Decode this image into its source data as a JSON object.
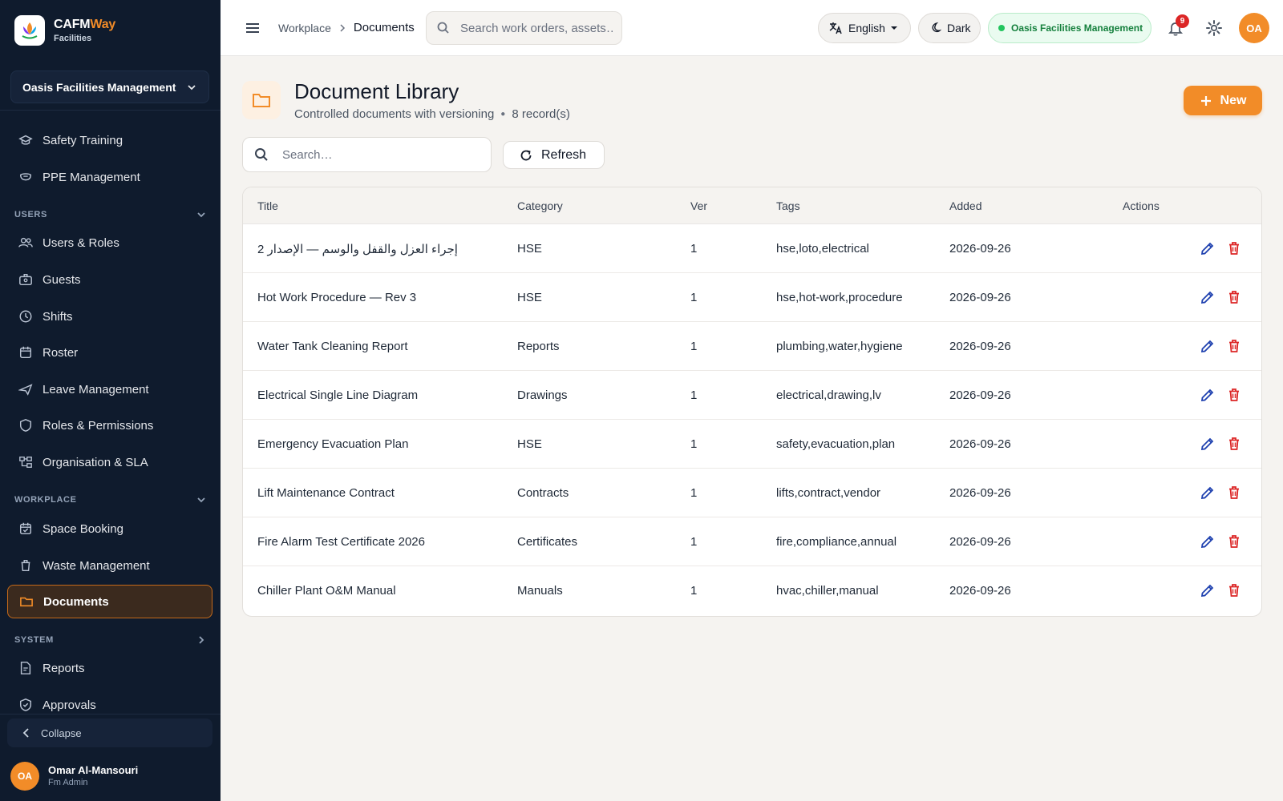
{
  "app": {
    "brand_name_main": "CAFM",
    "brand_name_accent": "Way",
    "brand_sub": "Facilities",
    "org_selector": "Oasis Facilities Management",
    "accent_color": "#f28c28"
  },
  "sidebar": {
    "top_items": [
      {
        "label": "Safety Training",
        "icon": "graduation-cap-icon"
      },
      {
        "label": "PPE Management",
        "icon": "mask-icon"
      }
    ],
    "sections": {
      "users": {
        "label": "USERS",
        "expanded": true
      },
      "workplace": {
        "label": "WORKPLACE",
        "expanded": true
      },
      "system": {
        "label": "SYSTEM",
        "expanded": false
      }
    },
    "users_items": [
      {
        "label": "Users & Roles",
        "icon": "users-icon"
      },
      {
        "label": "Guests",
        "icon": "badge-icon"
      },
      {
        "label": "Shifts",
        "icon": "clock-icon"
      },
      {
        "label": "Roster",
        "icon": "calendar-icon"
      },
      {
        "label": "Leave Management",
        "icon": "plane-icon"
      },
      {
        "label": "Roles & Permissions",
        "icon": "shield-icon"
      },
      {
        "label": "Organisation & SLA",
        "icon": "org-chart-icon"
      }
    ],
    "workplace_items": [
      {
        "label": "Space Booking",
        "icon": "calendar-check-icon"
      },
      {
        "label": "Waste Management",
        "icon": "trash-icon"
      },
      {
        "label": "Documents",
        "icon": "folder-icon",
        "active": true
      }
    ],
    "system_items": [
      {
        "label": "Reports",
        "icon": "report-icon"
      },
      {
        "label": "Approvals",
        "icon": "shield-check-icon"
      }
    ],
    "collapse_label": "Collapse",
    "user": {
      "initials": "OA",
      "name": "Omar Al-Mansouri",
      "role": "Fm Admin"
    }
  },
  "topbar": {
    "breadcrumb": [
      "Workplace",
      "Documents"
    ],
    "search_placeholder": "Search work orders, assets…",
    "language": "English",
    "theme": "Dark",
    "org_status": "Oasis Facilities Management",
    "notifications_count": "9",
    "user_initials": "OA"
  },
  "page": {
    "title": "Document Library",
    "subtitle": "Controlled documents with versioning",
    "record_count": "8 record(s)",
    "new_label": "New",
    "search_placeholder": "Search…",
    "refresh_label": "Refresh"
  },
  "table": {
    "columns": [
      "Title",
      "Category",
      "Ver",
      "Tags",
      "Added",
      "Actions"
    ],
    "rows": [
      {
        "title": "إجراء العزل والقفل والوسم — الإصدار 2",
        "category": "HSE",
        "ver": "1",
        "tags": "hse,loto,electrical",
        "added": "2026-09-26"
      },
      {
        "title": "Hot Work Procedure — Rev 3",
        "category": "HSE",
        "ver": "1",
        "tags": "hse,hot-work,procedure",
        "added": "2026-09-26"
      },
      {
        "title": "Water Tank Cleaning Report",
        "category": "Reports",
        "ver": "1",
        "tags": "plumbing,water,hygiene",
        "added": "2026-09-26"
      },
      {
        "title": "Electrical Single Line Diagram",
        "category": "Drawings",
        "ver": "1",
        "tags": "electrical,drawing,lv",
        "added": "2026-09-26"
      },
      {
        "title": "Emergency Evacuation Plan",
        "category": "HSE",
        "ver": "1",
        "tags": "safety,evacuation,plan",
        "added": "2026-09-26"
      },
      {
        "title": "Lift Maintenance Contract",
        "category": "Contracts",
        "ver": "1",
        "tags": "lifts,contract,vendor",
        "added": "2026-09-26"
      },
      {
        "title": "Fire Alarm Test Certificate 2026",
        "category": "Certificates",
        "ver": "1",
        "tags": "fire,compliance,annual",
        "added": "2026-09-26"
      },
      {
        "title": "Chiller Plant O&M Manual",
        "category": "Manuals",
        "ver": "1",
        "tags": "hvac,chiller,manual",
        "added": "2026-09-26"
      }
    ]
  }
}
